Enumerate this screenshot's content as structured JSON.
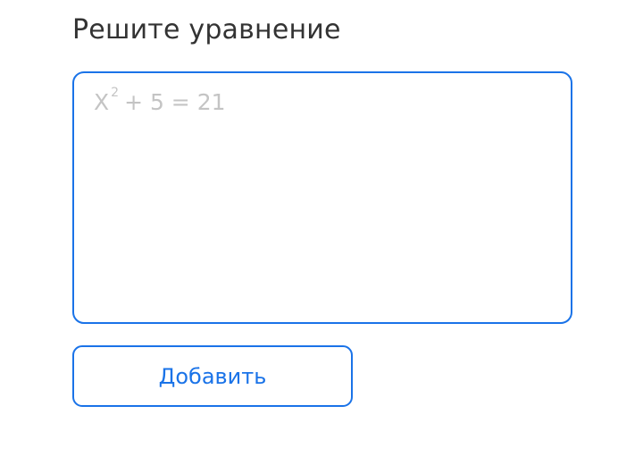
{
  "title": "Решите уравнение",
  "answer_input": {
    "placeholder_base": "X",
    "placeholder_exponent": "2",
    "placeholder_rest": "+ 5 = 21"
  },
  "add_button": {
    "label": "Добавить"
  },
  "colors": {
    "accent": "#1a73e8",
    "title_text": "#333333",
    "placeholder_text": "#c4c4c4",
    "background": "#ffffff"
  }
}
